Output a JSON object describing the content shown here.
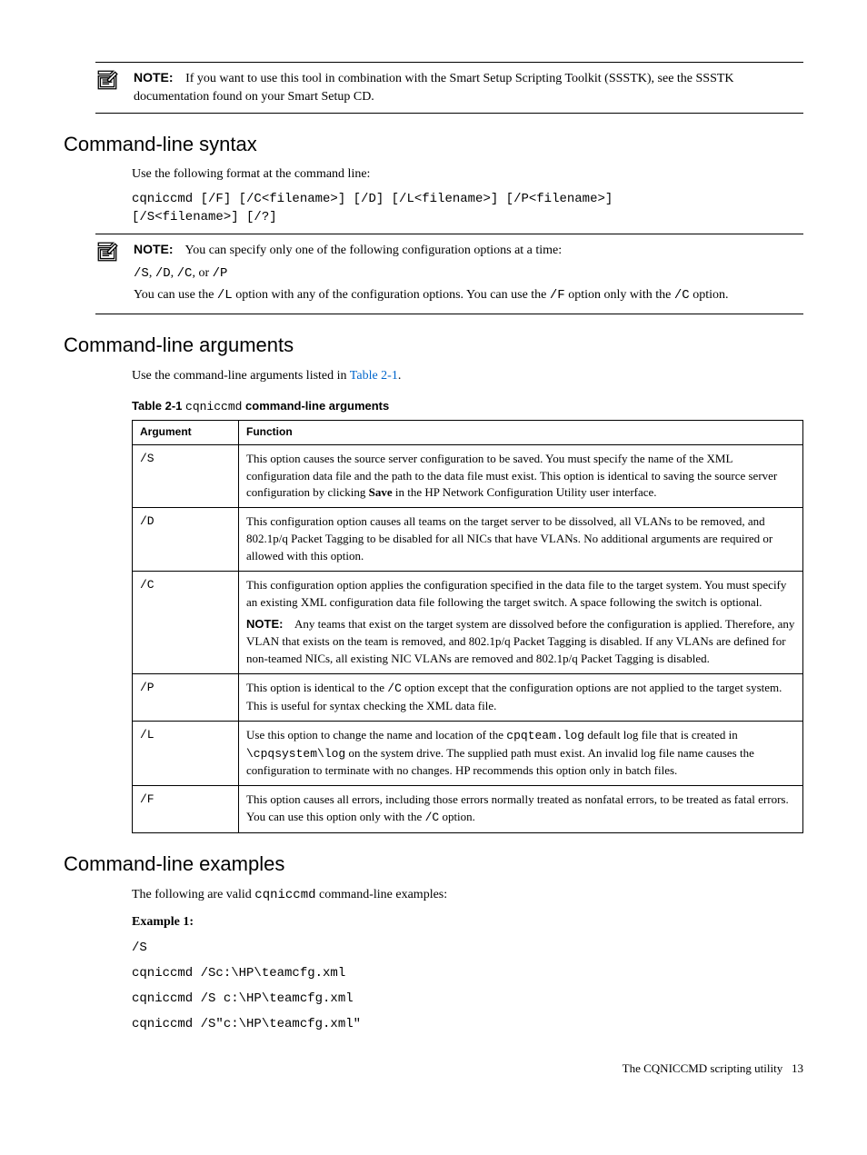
{
  "note1": {
    "label": "NOTE:",
    "text": "If you want to use this tool in combination with the Smart Setup Scripting Toolkit (SSSTK), see the SSSTK documentation found on your Smart Setup CD."
  },
  "syntax": {
    "heading": "Command-line syntax",
    "intro": "Use the following format at the command line:",
    "code": "cqniccmd [/F] [/C<filename>] [/D] [/L<filename>] [/P<filename>]\n[/S<filename>] [/?]"
  },
  "note2": {
    "label": "NOTE:",
    "text": "You can specify only one of the following configuration options at a time:",
    "opts_pre": "/S",
    "opts_mid1": ", ",
    "opts_d": "/D",
    "opts_mid2": ", ",
    "opts_c": "/C",
    "opts_or": ", or ",
    "opts_p": "/P",
    "tail_a": "You can use the ",
    "tail_l": "/L",
    "tail_b": " option with any of the configuration options. You can use the ",
    "tail_f": "/F",
    "tail_c": " option only with the ",
    "tail_cc": "/C",
    "tail_d": " option."
  },
  "args": {
    "heading": "Command-line arguments",
    "intro_a": "Use the command-line arguments listed in ",
    "intro_link": "Table 2-1",
    "intro_b": ".",
    "table_prefix": "Table 2-1 ",
    "table_code": "cqniccmd",
    "table_suffix": " command-line arguments",
    "th_arg": "Argument",
    "th_func": "Function",
    "rows": {
      "s": {
        "arg": "/S",
        "func_a": "This option causes the source server configuration to be saved. You must specify the name of the XML configuration data file and the path to the data file must exist. This option is identical to saving the source server configuration by clicking ",
        "func_bold": "Save",
        "func_b": " in the HP Network Configuration Utility user interface."
      },
      "d": {
        "arg": "/D",
        "func": "This configuration option causes all teams on the target server to be dissolved, all VLANs to be removed, and 802.1p/q Packet Tagging to be disabled for all NICs that have VLANs. No additional arguments are required or allowed with this option."
      },
      "c": {
        "arg": "/C",
        "func": "This configuration option applies the configuration specified in the data file to the target system. You must specify an existing XML configuration data file following the target switch. A space following the switch is optional.",
        "note_label": "NOTE:",
        "note": "Any teams that exist on the target system are dissolved before the configuration is applied. Therefore, any VLAN that exists on the team is removed, and 802.1p/q Packet Tagging is disabled. If any VLANs are defined for non-teamed NICs, all existing NIC VLANs are removed and 802.1p/q Packet Tagging is disabled."
      },
      "p": {
        "arg": "/P",
        "func_a": "This option is identical to the ",
        "func_code": "/C",
        "func_b": " option except that the configuration options are not applied to the target system. This is useful for syntax checking the XML data file."
      },
      "l": {
        "arg": "/L",
        "func_a": "Use this option to change the name and location of the ",
        "func_code1": "cpqteam.log",
        "func_b": " default log file that is created in ",
        "func_code2": "\\cpqsystem\\log",
        "func_c": " on the system drive. The supplied path must exist. An invalid log file name causes the configuration to terminate with no changes. HP recommends this option only in batch files."
      },
      "f": {
        "arg": "/F",
        "func_a": "This option causes all errors, including those errors normally treated as nonfatal errors, to be treated as fatal errors. You can use this option only with the ",
        "func_code": "/C",
        "func_b": " option."
      }
    }
  },
  "examples": {
    "heading": "Command-line examples",
    "intro_a": "The following are valid ",
    "intro_code": "cqniccmd",
    "intro_b": " command-line examples:",
    "ex1_label": "Example 1:",
    "ex1_code": "/S\ncqniccmd /Sc:\\HP\\teamcfg.xml\ncqniccmd /S c:\\HP\\teamcfg.xml\ncqniccmd /S\"c:\\HP\\teamcfg.xml\""
  },
  "footer": {
    "text": "The CQNICCMD scripting utility",
    "page": "13"
  }
}
